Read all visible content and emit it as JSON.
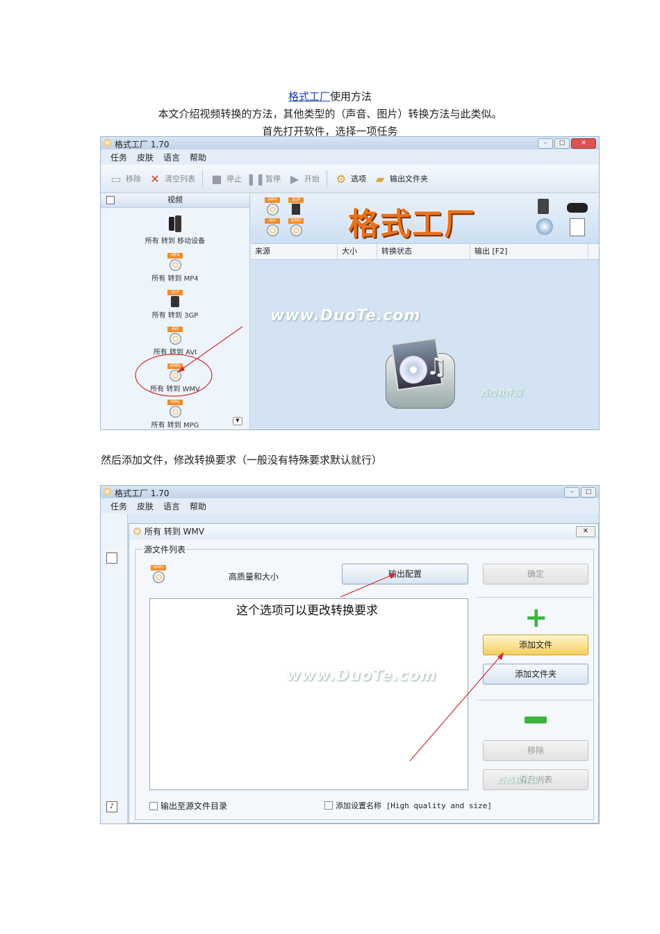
{
  "doc": {
    "title_link": "格式工厂",
    "title_rest": "使用方法",
    "intro": "本文介绍视频转换的方法，其他类型的（声音、图片）转换方法与此类似。",
    "step1": "首先打开软件，选择一项任务",
    "step2": "然后添加文件，修改转换要求（一般没有特殊要求默认就行）"
  },
  "app": {
    "window_title": "格式工厂 1.70",
    "menu": [
      "任务",
      "皮肤",
      "语言",
      "帮助"
    ],
    "toolbar": {
      "remove": "移除",
      "clear_list": "清空列表",
      "stop": "停止",
      "pause": "暂停",
      "start": "开始",
      "options": "选项",
      "output_folder": "输出文件夹"
    },
    "sidebar_header": "视频",
    "sidebar_items": [
      {
        "tag": "",
        "label": "所有 转到 移动设备"
      },
      {
        "tag": "MP4",
        "label": "所有 转到 MP4"
      },
      {
        "tag": "3GP",
        "label": "所有 转到 3GP"
      },
      {
        "tag": "AVI",
        "label": "所有 转到 AVI"
      },
      {
        "tag": "WMV",
        "label": "所有 转到 WMV"
      },
      {
        "tag": "MPG",
        "label": "所有 转到 MPG"
      }
    ],
    "banner_title": "格式工厂",
    "columns": [
      "来源",
      "大小",
      "转换状态",
      "输出 [F2]"
    ],
    "watermark": "www.DuoTe.com",
    "watermark2": "西西软件园"
  },
  "dialog": {
    "title": "所有 转到 WMV",
    "group_label": "源文件列表",
    "format_tag": "WMV",
    "quality": "高质量和大小",
    "output_config": "输出配置",
    "ok": "确定",
    "annotation": "这个选项可以更改转换要求",
    "add_file": "添加文件",
    "add_folder": "添加文件夹",
    "remove": "移除",
    "clear_list": "清空列表",
    "chk_output_source": "输出至源文件目录",
    "chk_add_setting": "添加设置名称 [High quality and size]"
  },
  "colors": {
    "annotation_red": "#d22b2b",
    "accent_orange": "#e8731c"
  }
}
